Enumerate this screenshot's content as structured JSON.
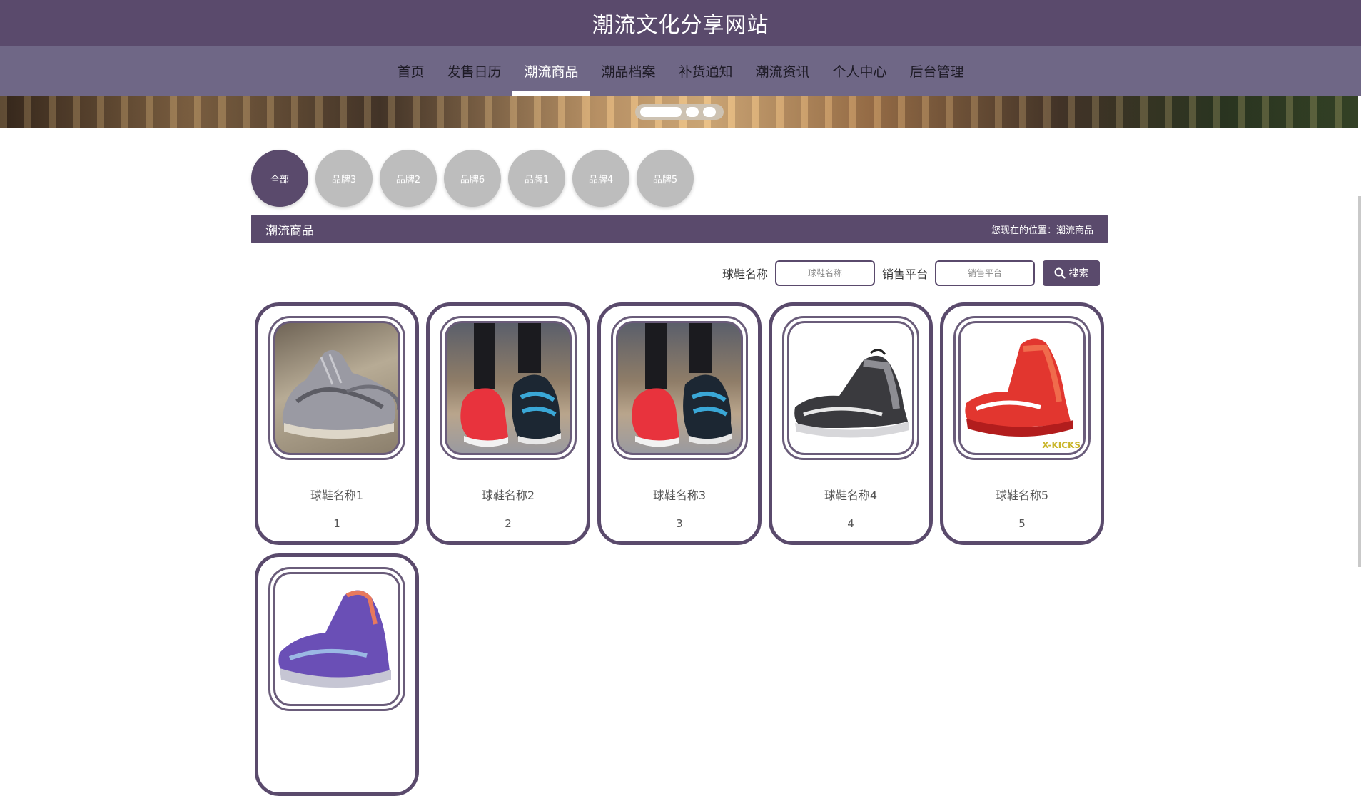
{
  "site_title": "潮流文化分享网站",
  "nav": [
    {
      "label": "首页",
      "active": false
    },
    {
      "label": "发售日历",
      "active": false
    },
    {
      "label": "潮流商品",
      "active": true
    },
    {
      "label": "潮品档案",
      "active": false
    },
    {
      "label": "补货通知",
      "active": false
    },
    {
      "label": "潮流资讯",
      "active": false
    },
    {
      "label": "个人中心",
      "active": false
    },
    {
      "label": "后台管理",
      "active": false
    }
  ],
  "banner": {
    "slide_count": 3,
    "active_slide": 1
  },
  "brands": [
    "全部",
    "品牌3",
    "品牌2",
    "品牌6",
    "品牌1",
    "品牌4",
    "品牌5"
  ],
  "active_brand": "全部",
  "section": {
    "title": "潮流商品",
    "location": "您现在的位置：潮流商品"
  },
  "search": {
    "name_label": "球鞋名称",
    "name_placeholder": "球鞋名称",
    "platform_label": "销售平台",
    "platform_placeholder": "销售平台",
    "button_label": "搜索"
  },
  "products": [
    {
      "name": "球鞋名称1",
      "price": "1",
      "image": "silver-sneaker-icon"
    },
    {
      "name": "球鞋名称2",
      "price": "2",
      "image": "red-blue-sneakers-icon"
    },
    {
      "name": "球鞋名称3",
      "price": "3",
      "image": "red-blue-sneakers-icon"
    },
    {
      "name": "球鞋名称4",
      "price": "4",
      "image": "black-sneaker-icon"
    },
    {
      "name": "球鞋名称5",
      "price": "5",
      "image": "red-sneaker-icon",
      "watermark": "X-KICKS"
    },
    {
      "name": "",
      "price": "",
      "image": "purple-sneaker-icon"
    }
  ],
  "colors": {
    "primary": "#5a4a6c",
    "nav_bg": "#6f6786",
    "brand_inactive": "#bdbdbd"
  }
}
